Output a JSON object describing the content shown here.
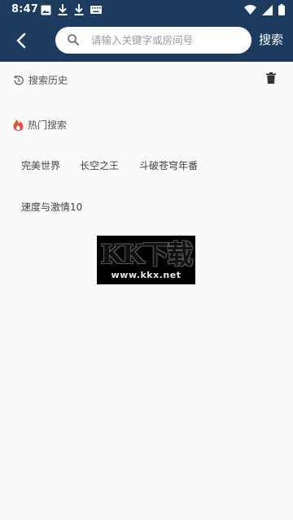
{
  "status_bar": {
    "time": "8:47",
    "left_icons": [
      "image-icon",
      "download-icon",
      "download-icon",
      "keyboard-icon"
    ],
    "right_icons": [
      "wifi-icon",
      "signal-icon",
      "battery-icon"
    ]
  },
  "header": {
    "back_icon": "chevron-left-icon",
    "search": {
      "placeholder": "请输入关键字或房间号",
      "value": ""
    },
    "search_button_label": "搜索",
    "background": "#1d3a5f"
  },
  "history": {
    "title": "搜索历史",
    "icon": "history-icon",
    "clear_icon": "trash-icon"
  },
  "hot": {
    "title": "热门搜索",
    "icon": "fire-icon",
    "icon_color": "#e8502f",
    "tags": [
      "完美世界",
      "长空之王",
      "斗破苍穹年番",
      "速度与激情10"
    ]
  },
  "watermark": {
    "logo_text": "KK下载",
    "url": "www.kkx.net"
  }
}
